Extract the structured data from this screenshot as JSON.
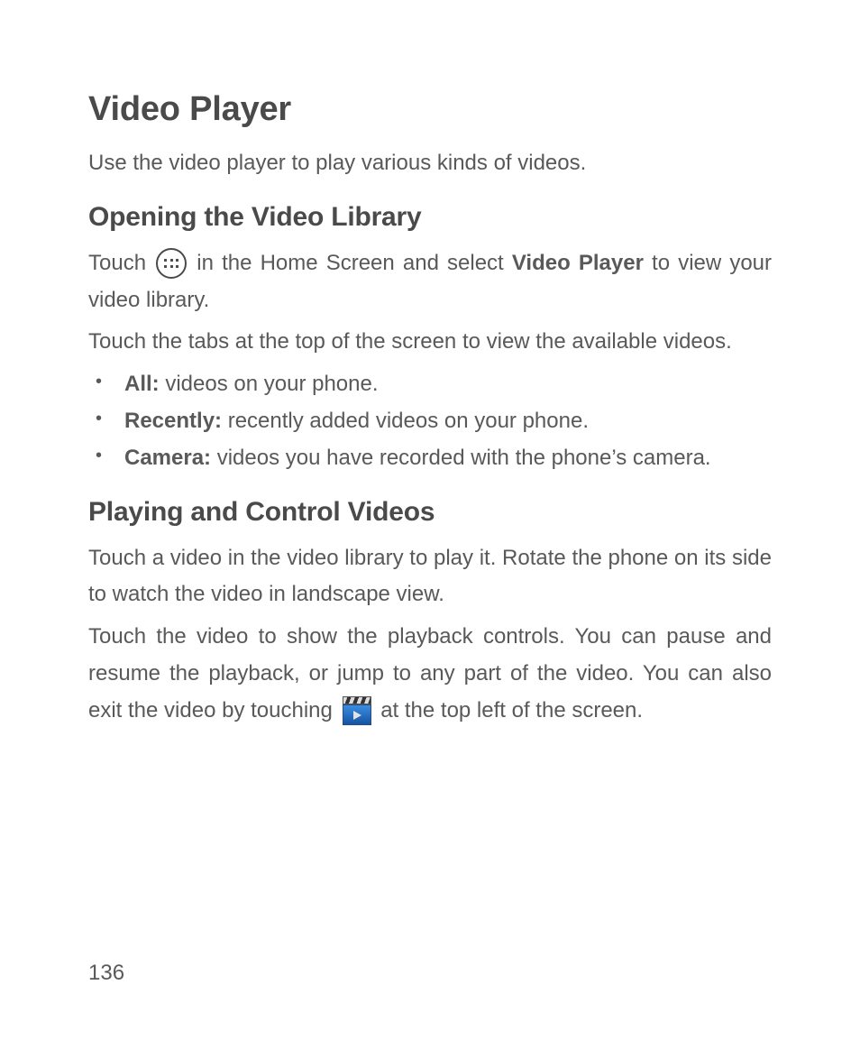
{
  "title": "Video Player",
  "intro": "Use the video player to play various kinds of videos.",
  "section1": {
    "heading": "Opening the Video Library",
    "p1_a": "Touch ",
    "p1_b": " in the Home Screen and select ",
    "p1_bold": "Video Player",
    "p1_c": " to view your video library.",
    "p2": "Touch the tabs at the top of the screen to view the available videos.",
    "bullets": [
      {
        "label": "All:",
        "desc": " videos on your phone."
      },
      {
        "label": "Recently:",
        "desc": " recently added videos on your phone."
      },
      {
        "label": "Camera:",
        "desc": " videos you have recorded with the phone’s camera."
      }
    ]
  },
  "section2": {
    "heading": "Playing and Control Videos",
    "p1": "Touch a video in the video library to play it. Rotate the phone on its side to watch the video in landscape view.",
    "p2_a": "Touch the video to show the playback controls. You can pause and resume the playback, or jump to any part of the video. You can also exit the video by touching ",
    "p2_b": " at the top left of the screen."
  },
  "page_number": "136"
}
